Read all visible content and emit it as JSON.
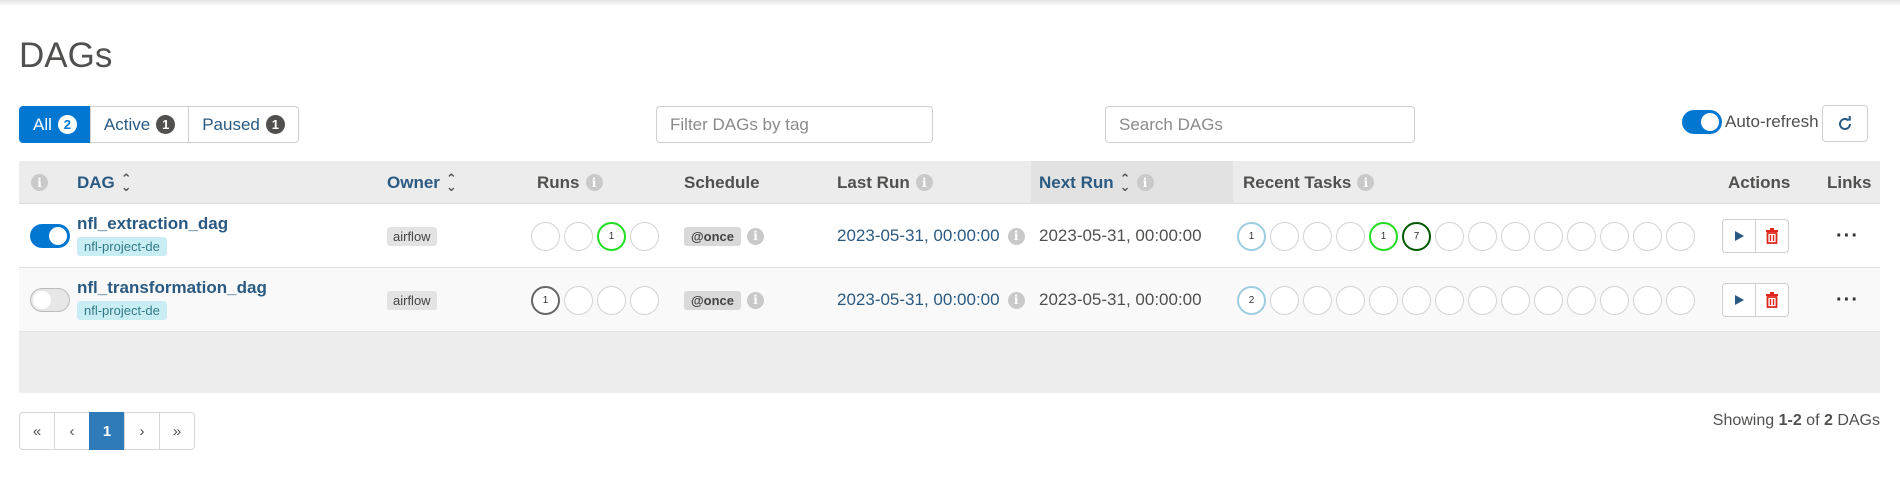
{
  "page": {
    "title": "DAGs"
  },
  "filters": [
    {
      "label": "All",
      "count": "2"
    },
    {
      "label": "Active",
      "count": "1"
    },
    {
      "label": "Paused",
      "count": "1"
    }
  ],
  "tag_filter": {
    "placeholder": "Filter DAGs by tag",
    "value": ""
  },
  "search": {
    "placeholder": "Search DAGs",
    "value": ""
  },
  "auto_refresh": {
    "label": "Auto-refresh",
    "enabled": true
  },
  "table": {
    "headers": {
      "dag": "DAG",
      "owner": "Owner",
      "runs": "Runs",
      "schedule": "Schedule",
      "last_run": "Last Run",
      "next_run": "Next Run",
      "recent_tasks": "Recent Tasks",
      "actions": "Actions",
      "links": "Links"
    },
    "rows": [
      {
        "paused": false,
        "name": "nfl_extraction_dag",
        "tag": "nfl-project-de",
        "owner": "airflow",
        "runs": [
          "",
          "",
          "1",
          ""
        ],
        "schedule": "@once",
        "last_run": "2023-05-31, 00:00:00",
        "next_run": "2023-05-31, 00:00:00",
        "recent_tasks": [
          "1",
          "",
          "",
          "",
          "1",
          "7",
          "",
          "",
          "",
          "",
          "",
          "",
          "",
          "",
          ""
        ]
      },
      {
        "paused": true,
        "name": "nfl_transformation_dag",
        "tag": "nfl-project-de",
        "owner": "airflow",
        "runs": [
          "1",
          "",
          "",
          ""
        ],
        "schedule": "@once",
        "last_run": "2023-05-31, 00:00:00",
        "next_run": "2023-05-31, 00:00:00",
        "recent_tasks": [
          "2",
          "",
          "",
          "",
          "",
          "",
          "",
          "",
          "",
          "",
          "",
          "",
          "",
          "",
          ""
        ]
      }
    ]
  },
  "pagination": {
    "first": "«",
    "prev": "‹",
    "current": "1",
    "next": "›",
    "last": "»"
  },
  "footer": {
    "prefix": "Showing",
    "range": "1-2",
    "of": "of",
    "total": "2",
    "suffix": "DAGs"
  },
  "colors": {
    "accent": "#0177d2",
    "success": "#22dd22",
    "running": "#015801",
    "link": "#2a5a82"
  }
}
